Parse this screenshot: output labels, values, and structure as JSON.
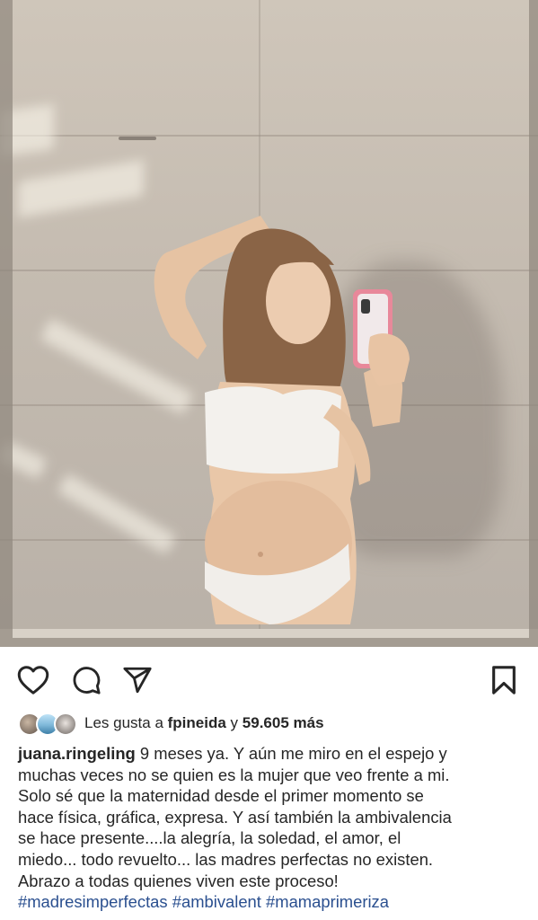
{
  "post": {
    "image_alt": "mirror selfie photo"
  },
  "actions": {
    "like_icon": "heart-icon",
    "comment_icon": "comment-icon",
    "share_icon": "paper-plane-icon",
    "save_icon": "bookmark-icon"
  },
  "likes": {
    "prefix": "Les gusta a",
    "user": "fpineida",
    "connector": "y",
    "count": "59.605 más"
  },
  "caption": {
    "username": "juana.ringeling",
    "lines": [
      "9 meses ya. Y aún me miro en el espejo y",
      "muchas veces no se quien es la mujer que veo frente a mi.",
      "Solo sé que la maternidad desde el primer momento se",
      "hace física, gráfica, expresa. Y así también la ambivalencia",
      "se hace presente....la alegría, la soledad, el amor, el",
      "miedo... todo revuelto... las madres perfectas no existen.",
      "Abrazo a todas quienes viven este proceso!"
    ],
    "hashtags": [
      "#madresimperfectas",
      "#ambivalent",
      "#mamaprimeriza"
    ]
  },
  "colors": {
    "text": "#262626",
    "hashtag": "#2a4f8f",
    "background": "#ffffff"
  }
}
